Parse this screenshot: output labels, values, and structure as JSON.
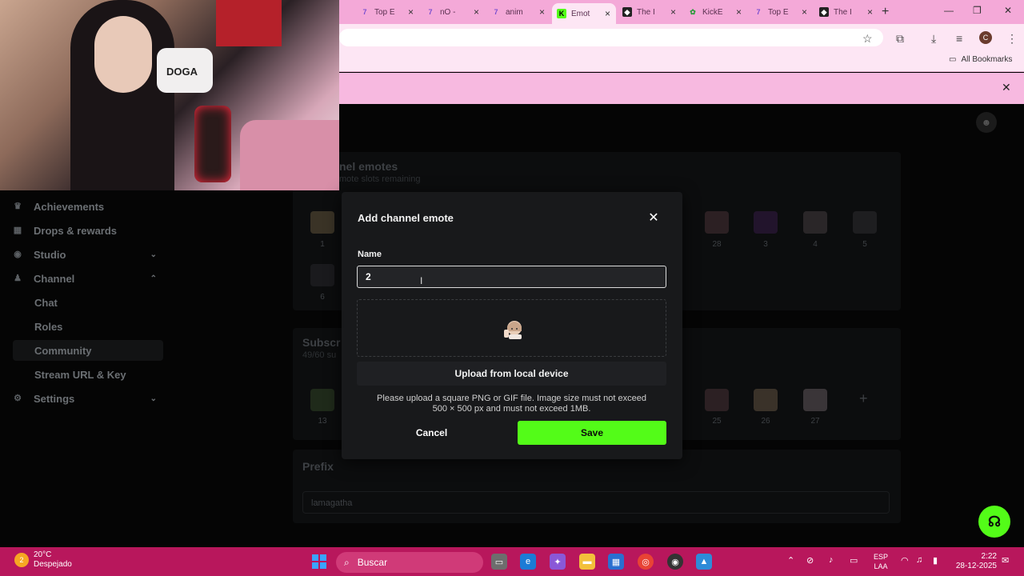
{
  "browser": {
    "tabs": [
      {
        "label": "Top E",
        "icon": "7tv-icon",
        "color": "#3c2b6e"
      },
      {
        "label": "nO -",
        "icon": "7tv-icon",
        "color": "#3c2b6e"
      },
      {
        "label": "anim",
        "icon": "7tv-icon",
        "color": "#3c2b6e"
      },
      {
        "label": "Emot",
        "icon": "kick-icon",
        "color": "#53fc18",
        "active": true
      },
      {
        "label": "The I",
        "icon": "kick-logo-icon",
        "color": "#222"
      },
      {
        "label": "KickE",
        "icon": "kickemotes-icon",
        "color": "#2b9b3a"
      },
      {
        "label": "Top E",
        "icon": "7tv-icon",
        "color": "#3c2b6e"
      },
      {
        "label": "The I",
        "icon": "kick-logo-icon",
        "color": "#222"
      }
    ],
    "profile_initial": "C",
    "all_bookmarks": "All Bookmarks"
  },
  "webcam": {
    "pillow_text": "DOGA"
  },
  "sidebar": {
    "items": [
      {
        "label": "Achievements",
        "icon": "trophy-icon"
      },
      {
        "label": "Drops & rewards",
        "icon": "gift-icon"
      },
      {
        "label": "Studio",
        "icon": "studio-icon",
        "chevron": "down"
      },
      {
        "label": "Channel",
        "icon": "users-icon",
        "chevron": "up"
      },
      {
        "label": "Chat"
      },
      {
        "label": "Roles"
      },
      {
        "label": "Community",
        "selected": true
      },
      {
        "label": "Stream URL & Key"
      },
      {
        "label": "Settings",
        "icon": "gear-icon",
        "chevron": "down"
      }
    ]
  },
  "background": {
    "channel_emotes_title": "nel emotes",
    "channel_emotes_sub": "mote slots remaining",
    "row1_labels": [
      "1",
      "28",
      "3",
      "4",
      "5"
    ],
    "row2_labels": [
      "6"
    ],
    "subs_title": "Subscr",
    "subs_sub": "49/60 su",
    "row3_labels": [
      "13",
      "25",
      "26",
      "27"
    ],
    "prefix_title": "Prefix",
    "prefix_value": "lamagatha"
  },
  "modal": {
    "title": "Add channel emote",
    "name_label": "Name",
    "name_value": "2",
    "upload_label": "Upload from local device",
    "hint_line1": "Please upload a square PNG or GIF file. Image size must not exceed",
    "hint_line2": "500 × 500 px and must not exceed 1MB.",
    "cancel_label": "Cancel",
    "save_label": "Save",
    "accent": "#53fc18"
  },
  "taskbar": {
    "weather_temp": "20°C",
    "weather_desc": "Despejado",
    "search_placeholder": "Buscar",
    "lang_line1": "ESP",
    "lang_line2": "LAA",
    "time": "2:22",
    "date": "28-12-2025"
  }
}
